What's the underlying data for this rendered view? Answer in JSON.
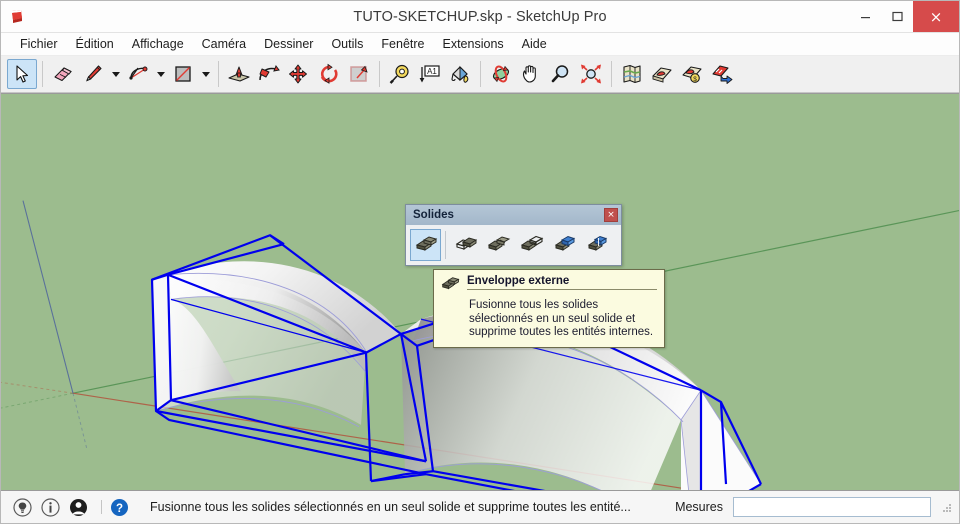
{
  "window": {
    "title": "TUTO-SKETCHUP.skp - SketchUp Pro",
    "app_icon": "sketchup-logo-icon",
    "controls": {
      "minimize": "minimize-icon",
      "maximize": "maximize-icon",
      "close": "×"
    },
    "close_color": "#d64b4b"
  },
  "menubar": {
    "items": [
      {
        "label": "Fichier"
      },
      {
        "label": "Édition"
      },
      {
        "label": "Affichage"
      },
      {
        "label": "Caméra"
      },
      {
        "label": "Dessiner"
      },
      {
        "label": "Outils"
      },
      {
        "label": "Fenêtre"
      },
      {
        "label": "Extensions"
      },
      {
        "label": "Aide"
      }
    ]
  },
  "toolbar": {
    "items": [
      {
        "name": "select-tool",
        "icon": "arrow-cursor-icon",
        "active": true
      },
      {
        "name": "eraser-tool",
        "icon": "eraser-icon",
        "active": false
      },
      {
        "name": "pencil-tool",
        "icon": "pencil-icon",
        "active": false
      },
      {
        "name": "arc-tool",
        "icon": "arc-icon",
        "active": false
      },
      {
        "name": "rectangle-tool",
        "icon": "rectangle-icon",
        "active": false
      },
      {
        "name": "push-pull-tool",
        "icon": "push-pull-icon",
        "active": false
      },
      {
        "name": "follow-me-tool",
        "icon": "follow-me-icon",
        "active": false
      },
      {
        "name": "move-tool",
        "icon": "move-arrows-icon",
        "active": false
      },
      {
        "name": "rotate-tool",
        "icon": "rotate-icon",
        "active": false
      },
      {
        "name": "scale-tool",
        "icon": "scale-icon",
        "active": false
      },
      {
        "name": "tape-measure-tool",
        "icon": "tape-measure-icon",
        "active": false
      },
      {
        "name": "dimension-tool",
        "icon": "text-a1-icon",
        "active": false
      },
      {
        "name": "paint-bucket-tool",
        "icon": "paint-bucket-icon",
        "active": false
      },
      {
        "name": "orbit-tool",
        "icon": "orbit-icon",
        "active": false
      },
      {
        "name": "pan-tool",
        "icon": "hand-pan-icon",
        "active": false
      },
      {
        "name": "zoom-tool",
        "icon": "magnifier-icon",
        "active": false
      },
      {
        "name": "zoom-extents-tool",
        "icon": "zoom-extents-icon",
        "active": false
      },
      {
        "name": "geo-location-tool",
        "icon": "map-location-icon",
        "active": false
      },
      {
        "name": "photo-texture-tool",
        "icon": "photo-texture-icon",
        "active": false
      },
      {
        "name": "warehouse-tool",
        "icon": "3d-warehouse-icon",
        "active": false
      },
      {
        "name": "share-model-tool",
        "icon": "share-model-icon",
        "active": false
      }
    ]
  },
  "solides_panel": {
    "title": "Solides",
    "close_label": "×",
    "buttons": [
      {
        "name": "outer-shell-tool",
        "icon": "outer-shell-icon",
        "active": true
      },
      {
        "name": "intersect-tool",
        "icon": "intersect-solids-icon",
        "active": false
      },
      {
        "name": "union-tool",
        "icon": "union-solids-icon",
        "active": false
      },
      {
        "name": "subtract-tool",
        "icon": "subtract-solids-icon",
        "active": false
      },
      {
        "name": "trim-tool",
        "icon": "trim-solids-icon",
        "active": false
      },
      {
        "name": "split-tool",
        "icon": "split-solids-icon",
        "active": false
      }
    ]
  },
  "tooltip": {
    "icon": "outer-shell-icon",
    "title": "Enveloppe externe",
    "body": "Fusionne tous les solides sélectionnés en un seul solide et supprime toutes les entités internes."
  },
  "statusbar": {
    "icons": [
      {
        "name": "hint-bulb-icon"
      },
      {
        "name": "info-icon"
      },
      {
        "name": "account-person-icon"
      },
      {
        "name": "help-question-icon"
      }
    ],
    "message": "Fusionne tous les solides sélectionnés en un seul solide et supprime toutes les entité...",
    "measure_label": "Mesures",
    "measure_value": "",
    "measure_placeholder": ""
  },
  "canvas": {
    "background_color": "#9cbc8e",
    "selection_color": "#0000ee",
    "axes": {
      "red_axis_color": "#b05a42",
      "green_axis_color": "#4f8f4f",
      "blue_axis_color": "#4a5f9e"
    },
    "model_description": "Two curved arch solids in white with blue selection bounding boxes on green ground plane"
  }
}
